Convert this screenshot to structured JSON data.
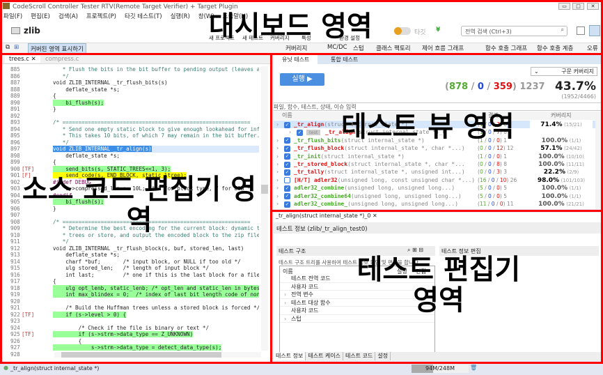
{
  "window": {
    "title": "CodeScroll Controller Tester RTV(Remote Target Verifier) + Target Plugin",
    "min": "▭",
    "max": "□",
    "close": "✕"
  },
  "menu": [
    "파일(F)",
    "편집(E)",
    "검색(A)",
    "프로젝트(P)",
    "타깃 테스트(T)",
    "실행(R)",
    "창(W)",
    "도움말(H)"
  ],
  "toolbar": {
    "project": "zlib",
    "new_project": "새 프로젝트",
    "new_test": "새 테스트",
    "coverage": "커버리지",
    "properties": "특성",
    "env": "환경 설정",
    "target": "타깃",
    "search_placeholder": "전역 검색 (Ctrl+3)"
  },
  "toolbar2": {
    "show_covered": "커버된 영역 표시하기",
    "items": [
      "커버리지",
      "MC/DC",
      "스텁",
      "클래스 팩토리",
      "제어 흐름 그래프",
      "함수 호출 그래프",
      "함수 호출 계층",
      "오류"
    ]
  },
  "editor": {
    "tabs": [
      "trees.c",
      "compress.c"
    ],
    "lines": [
      [
        "885",
        "",
        "   * Flush the bits in the bit buffer to pending output (leaves at m",
        "cm",
        ""
      ],
      [
        "886",
        "",
        "   */",
        "cm",
        ""
      ],
      [
        "887",
        "",
        "void ZLIB_INTERNAL _tr_flush_bits(s)",
        "",
        ""
      ],
      [
        "888",
        "",
        "    deflate_state *s;",
        "",
        ""
      ],
      [
        "889",
        "",
        "{",
        "",
        ""
      ],
      [
        "890",
        "",
        "    bi_flush(s);",
        "",
        "green"
      ],
      [
        "891",
        "",
        "}",
        "",
        ""
      ],
      [
        "892",
        "",
        "",
        "",
        ""
      ],
      [
        "893",
        "",
        "/* ===========================================================",
        "cm",
        ""
      ],
      [
        "894",
        "",
        "   * Send one empty static block to give enough lookahead for inflat",
        "cm",
        ""
      ],
      [
        "895",
        "",
        "   * This takes 10 bits, of which 7 may remain in the bit buffer.",
        "cm",
        ""
      ],
      [
        "896",
        "",
        "   */",
        "cm",
        ""
      ],
      [
        "897",
        "",
        "void ZLIB_INTERNAL _tr_align(s)",
        "",
        "sel"
      ],
      [
        "898",
        "",
        "    deflate_state *s;",
        "",
        ""
      ],
      [
        "899",
        "",
        "{",
        "",
        ""
      ],
      [
        "900",
        "[TF]",
        "    send_bits(s, STATIC_TREES<<1, 3);",
        "",
        "green"
      ],
      [
        "901",
        "[F]",
        "    send_code(s, END_BLOCK, static_ltree);",
        "",
        "yellow"
      ],
      [
        "902",
        "",
        "#ifdef DEBUG",
        "kw",
        ""
      ],
      [
        "903",
        "",
        "    s->compressed_len += 10L; /* 3 for block type, 7 for EOB */",
        "",
        ""
      ],
      [
        "904",
        "",
        "#endif",
        "kw",
        ""
      ],
      [
        "905",
        "",
        "    bi_flush(s);",
        "",
        "green"
      ],
      [
        "906",
        "",
        "}",
        "",
        ""
      ],
      [
        "907",
        "",
        "",
        "",
        ""
      ],
      [
        "908",
        "",
        "/* ===========================================================",
        "cm",
        ""
      ],
      [
        "909",
        "",
        "   * Determine the best encoding for the current block: dynamic tree",
        "cm",
        ""
      ],
      [
        "910",
        "",
        "   * trees or store, and output the encoded block to the zip file.",
        "cm",
        ""
      ],
      [
        "911",
        "",
        "   */",
        "cm",
        ""
      ],
      [
        "912",
        "",
        "void ZLIB_INTERNAL _tr_flush_block(s, buf, stored_len, last)",
        "",
        ""
      ],
      [
        "913",
        "",
        "    deflate_state *s;",
        "",
        ""
      ],
      [
        "914",
        "",
        "    charf *buf;       /* input block, or NULL if too old */",
        "",
        ""
      ],
      [
        "915",
        "",
        "    ulg stored_len;   /* length of input block */",
        "",
        ""
      ],
      [
        "916",
        "",
        "    int last;         /* one if this is the last block for a file",
        "",
        ""
      ],
      [
        "917",
        "",
        "{",
        "",
        ""
      ],
      [
        "918",
        "",
        "    ulg opt_lenb, static_lenb; /* opt_len and static_len in bytes",
        "",
        "green"
      ],
      [
        "919",
        "",
        "    int max_blindex = 0;  /* index of last bit length code of non",
        "",
        "green"
      ],
      [
        "920",
        "",
        "",
        "",
        ""
      ],
      [
        "921",
        "",
        "    /* Build the Huffman trees unless a stored block is forced */",
        "",
        ""
      ],
      [
        "922",
        "[TF]",
        "    if (s->level > 0) {",
        "",
        "green"
      ],
      [
        "923",
        "",
        "",
        "",
        ""
      ],
      [
        "924",
        "",
        "        /* Check if the file is binary or text */",
        "",
        ""
      ],
      [
        "925",
        "[TF]",
        "        if (s->strm->data_type == Z_UNKNOWN)",
        "",
        "green"
      ],
      [
        "926",
        "",
        "        {",
        "",
        ""
      ],
      [
        "927",
        "",
        "            s->strm->data_type = detect_data_type(s);",
        "",
        "green"
      ],
      [
        "928",
        "",
        "        }",
        "",
        ""
      ]
    ]
  },
  "testview": {
    "tabs": [
      "유닛 테스트",
      "통합 테스트"
    ],
    "run": "실행 ▶",
    "coverage_type": "구문 커버리지",
    "success": "878",
    "fail_mid": "0",
    "fail": "359",
    "total": "1237",
    "percent": "43.7%",
    "ratio": "(1952/4466)",
    "filter_placeholder": "파일, 함수, 테스트, 상태, 이슈 입력",
    "columns": [
      "이름",
      "결과",
      "커버리지"
    ],
    "rows": [
      {
        "name": "_tr_align",
        "args": "(struct internal_state *)",
        "color": "#d11",
        "res": [
          "1",
          "0",
          "7"
        ],
        "tot": "8",
        "cov": "71.4%",
        "covr": "(15/21)",
        "indent": 0,
        "sel": true,
        "chk": true,
        "tag": ""
      },
      {
        "name": "_tr_align",
        "args": "(struct internal_state *)_0",
        "color": "#d11",
        "res": [
          "1",
          "0",
          "7"
        ],
        "tot": "8",
        "cov": "",
        "covr": "",
        "indent": 1,
        "chk": true,
        "tag": "test"
      },
      {
        "name": "_tr_flush_bits",
        "args": "(struct internal_state *)",
        "color": "#4a2",
        "res": [
          "1",
          "0",
          "0"
        ],
        "tot": "1",
        "cov": "100.0%",
        "covr": "(1/1)",
        "indent": 0,
        "chk": true,
        "tag": ""
      },
      {
        "name": "_tr_flush_block",
        "args": "(struct internal_state *, char *...)",
        "color": "#d11",
        "res": [
          "0",
          "0",
          "12"
        ],
        "tot": "12",
        "cov": "57.1%",
        "covr": "(24/42)",
        "indent": 0,
        "chk": true,
        "tag": ""
      },
      {
        "name": "_tr_init",
        "args": "(struct internal_state *)",
        "color": "#4a2",
        "res": [
          "1",
          "0",
          "0"
        ],
        "tot": "1",
        "cov": "100.0%",
        "covr": "(10/10)",
        "indent": 0,
        "chk": true,
        "tag": ""
      },
      {
        "name": "_tr_stored_block",
        "args": "(struct internal_state *, char *...",
        "color": "#d11",
        "res": [
          "0",
          "0",
          "8"
        ],
        "tot": "8",
        "cov": "100.0%",
        "covr": "(11/11)",
        "indent": 0,
        "chk": true,
        "tag": ""
      },
      {
        "name": "_tr_tally",
        "args": "(struct internal_state *, unsigned int...)",
        "color": "#d11",
        "res": [
          "0",
          "0",
          "3"
        ],
        "tot": "3",
        "cov": "22.2%",
        "covr": "(2/9)",
        "indent": 0,
        "chk": true,
        "tag": ""
      },
      {
        "name": "[H/T] adler32",
        "args": "(unsigned long, const unsigned char *...)",
        "color": "#d11",
        "res": [
          "16",
          "0",
          "10"
        ],
        "tot": "26",
        "cov": "98.0%",
        "covr": "(101/103)",
        "indent": 0,
        "chk": false,
        "tag": ""
      },
      {
        "name": "adler32_combine",
        "args": "(unsigned long, unsigned long...)",
        "color": "#4a2",
        "res": [
          "5",
          "0",
          "0"
        ],
        "tot": "5",
        "cov": "100.0%",
        "covr": "(1/1)",
        "indent": 0,
        "chk": true,
        "tag": ""
      },
      {
        "name": "adler32_combine64",
        "args": "(unsigned long, unsigned long...)",
        "color": "#4a2",
        "res": [
          "5",
          "0",
          "0"
        ],
        "tot": "5",
        "cov": "100.0%",
        "covr": "(1/1)",
        "indent": 0,
        "chk": true,
        "tag": ""
      },
      {
        "name": "adler32_combine_",
        "args": "(unsigned long, unsigned long...)",
        "color": "#4a2",
        "res": [
          "11",
          "0",
          "0"
        ],
        "tot": "11",
        "cov": "100.0%",
        "covr": "(21/21)",
        "indent": 0,
        "chk": true,
        "tag": ""
      }
    ]
  },
  "testeditor": {
    "tab": "_tr_align(struct internal_state *)_0",
    "header": "테스트 정보 (zlib/_tr_align_test0)",
    "structure_title": "테스트 구조",
    "structure_desc": "테스트 구조 트리를 사용하여 테스트 정보 확인 및 편집을 합니다.",
    "info_edit_title": "테스트 정보 편집",
    "tree_cols": [
      "이름",
      "설정",
      "편집"
    ],
    "tree": [
      {
        "label": "테스트 전역 코드",
        "exp": false
      },
      {
        "label": "사용자 코드",
        "exp": false
      },
      {
        "label": "전역 변수",
        "exp": true
      },
      {
        "label": "테스트 대상 함수",
        "exp": true
      },
      {
        "label": "사용자 코드",
        "exp": false
      },
      {
        "label": "스텁",
        "exp": true
      }
    ],
    "bottom_tabs": [
      "테스트 정보",
      "테스트 케이스",
      "테스트 코드",
      "설정"
    ]
  },
  "statusbar": {
    "function": "_tr_align(struct internal_state *)",
    "memory": "94M/248M",
    "memory_used": 0.38
  },
  "annotations": {
    "dashboard": "대시보드 영역",
    "editor": "소스 코드 편집기 영역",
    "testview": "테스트 뷰 영역",
    "testeditor": "테스트 편집기 영역"
  }
}
